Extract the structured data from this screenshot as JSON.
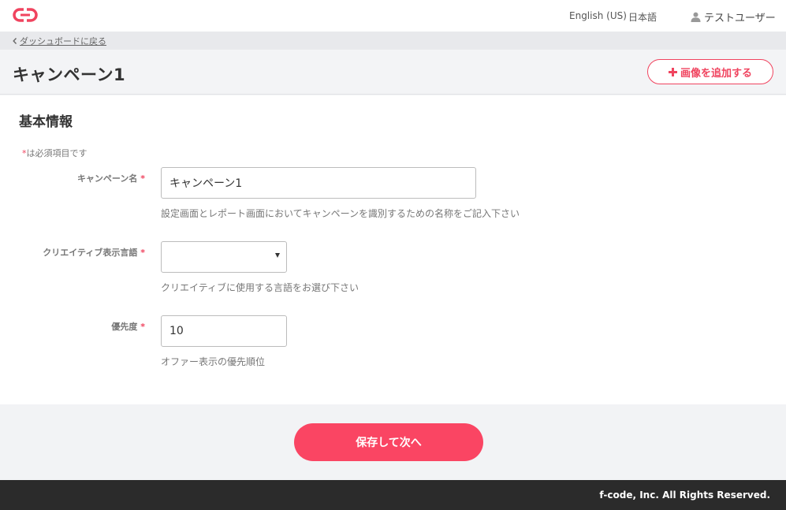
{
  "header": {
    "logo_icon": "chain-link-logo",
    "brand_color": "#f0445f",
    "languages": [
      "English (US)",
      "日本語"
    ],
    "user_name": "テストユーザー"
  },
  "breadcrumb": {
    "back_label": "ダッシュボードに戻る"
  },
  "page": {
    "title": "キャンペーン1",
    "add_image_label": "画像を追加する"
  },
  "form": {
    "section_title": "基本情報",
    "required_marker": "*",
    "required_note": "は必須項目です",
    "fields": {
      "name": {
        "label": "キャンペーン名",
        "value": "キャンペーン1",
        "help": "設定画面とレポート画面においてキャンペーンを識別するための名称をご記入下さい"
      },
      "language": {
        "label": "クリエイティブ表示言語",
        "value": "",
        "help": "クリエイティブに使用する言語をお選び下さい"
      },
      "priority": {
        "label": "優先度",
        "value": "10",
        "help": "オファー表示の優先順位"
      }
    }
  },
  "actions": {
    "save_next_label": "保存して次へ",
    "accent_color": "#fa4563"
  },
  "footer": {
    "copyright": "f-code, Inc. All Rights Reserved."
  }
}
